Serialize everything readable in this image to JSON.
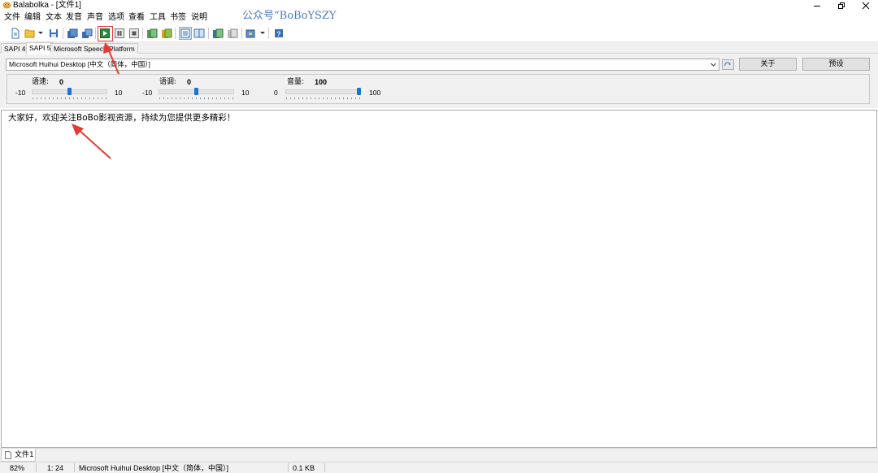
{
  "window": {
    "title": "Balabolka - [文件1]",
    "watermark": "公众号“BoBoYSZY"
  },
  "menu": [
    "文件",
    "编辑",
    "文本",
    "发音",
    "声音",
    "选项",
    "查看",
    "工具",
    "书签",
    "说明"
  ],
  "toolbar": {
    "icons": [
      "new-document-icon",
      "open-folder-icon",
      "save-icon",
      "save-audio-icon",
      "split-audio-icon",
      "play-icon",
      "pause-icon",
      "stop-icon",
      "read-clipboard-icon",
      "export-icon",
      "spell-check-icon",
      "text-view-icon",
      "convert-icon",
      "batch-icon",
      "voice-icon",
      "help-icon"
    ]
  },
  "engine_tabs": {
    "items": [
      "SAPI 4",
      "SAPI 5",
      "Microsoft Speech Platform"
    ],
    "selected": "SAPI 5"
  },
  "voice": {
    "selected": "Microsoft Huihui Desktop [中文（简体，中国）]",
    "about_button": "关于",
    "preset_button": "预设"
  },
  "sliders": {
    "rate": {
      "label": "语速:",
      "value": "0",
      "min": "-10",
      "max": "10",
      "level": 0.5
    },
    "pitch": {
      "label": "语调:",
      "value": "0",
      "min": "-10",
      "max": "10",
      "level": 0.5
    },
    "volume": {
      "label": "音量:",
      "value": "100",
      "min": "0",
      "max": "100",
      "level": 1.0
    }
  },
  "editor": {
    "text": "大家好，欢迎关注BoBo影视资源，持续为您提供更多精彩！"
  },
  "document_tabs": [
    "文件1"
  ],
  "status": {
    "zoom": "82%",
    "position": "1:  24",
    "voice": "Microsoft Huihui Desktop [中文（简体，中国）]",
    "size": "0.1 KB"
  },
  "colors": {
    "accent": "#1a73d6",
    "annotation": "#e53935",
    "watermark": "#4a78c8"
  }
}
